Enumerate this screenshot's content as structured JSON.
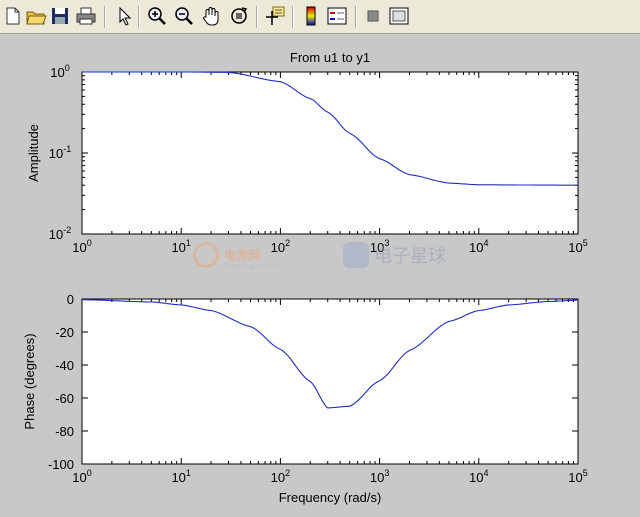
{
  "toolbar": {
    "buttons": [
      {
        "name": "new-figure-icon",
        "label": "New Figure"
      },
      {
        "name": "open-file-icon",
        "label": "Open File"
      },
      {
        "name": "save-figure-icon",
        "label": "Save Figure"
      },
      {
        "name": "print-figure-icon",
        "label": "Print Figure"
      },
      {
        "name": "edit-plot-icon",
        "label": "Edit Plot"
      },
      {
        "name": "zoom-in-icon",
        "label": "Zoom In"
      },
      {
        "name": "zoom-out-icon",
        "label": "Zoom Out"
      },
      {
        "name": "pan-icon",
        "label": "Pan"
      },
      {
        "name": "rotate-3d-icon",
        "label": "Rotate 3D"
      },
      {
        "name": "data-cursor-icon",
        "label": "Data Cursor"
      },
      {
        "name": "insert-colorbar-icon",
        "label": "Insert Colorbar"
      },
      {
        "name": "insert-legend-icon",
        "label": "Insert Legend"
      },
      {
        "name": "hide-plot-tools-icon",
        "label": "Hide Plot Tools"
      },
      {
        "name": "show-plot-tools-icon",
        "label": "Show Plot Tools"
      }
    ]
  },
  "watermark": {
    "left_brand": "电源网",
    "left_site": "DianYuan.com",
    "right_brand": "电子星球"
  },
  "chart_data": [
    {
      "type": "line",
      "title": "From u1 to y1",
      "xlabel": "",
      "ylabel": "Amplitude",
      "xscale": "log",
      "yscale": "log",
      "xlim": [
        1,
        100000
      ],
      "ylim": [
        0.01,
        1
      ],
      "x_ticks": [
        {
          "value": 1,
          "base": "10",
          "exp": "0"
        },
        {
          "value": 10,
          "base": "10",
          "exp": "1"
        },
        {
          "value": 100,
          "base": "10",
          "exp": "2"
        },
        {
          "value": 1000,
          "base": "10",
          "exp": "3"
        },
        {
          "value": 10000,
          "base": "10",
          "exp": "4"
        },
        {
          "value": 100000,
          "base": "10",
          "exp": "5"
        }
      ],
      "y_ticks": [
        {
          "value": 0.01,
          "base": "10",
          "exp": "-2"
        },
        {
          "value": 0.1,
          "base": "10",
          "exp": "-1"
        },
        {
          "value": 1,
          "base": "10",
          "exp": "0"
        }
      ],
      "grid": false,
      "series": [
        {
          "color": "#1f2fbf",
          "x": [
            1,
            10,
            30,
            100,
            200,
            300,
            500,
            1000,
            2000,
            5000,
            10000,
            100000
          ],
          "y": [
            1,
            1,
            0.99,
            0.76,
            0.47,
            0.32,
            0.175,
            0.085,
            0.054,
            0.0425,
            0.0405,
            0.04
          ]
        }
      ]
    },
    {
      "type": "line",
      "title": "",
      "xlabel": "Frequency (rad/s)",
      "ylabel": "Phase (degrees)",
      "xscale": "log",
      "yscale": "linear",
      "xlim": [
        1,
        100000
      ],
      "ylim": [
        -100,
        0
      ],
      "x_ticks": [
        {
          "value": 1,
          "base": "10",
          "exp": "0"
        },
        {
          "value": 10,
          "base": "10",
          "exp": "1"
        },
        {
          "value": 100,
          "base": "10",
          "exp": "2"
        },
        {
          "value": 1000,
          "base": "10",
          "exp": "3"
        },
        {
          "value": 10000,
          "base": "10",
          "exp": "4"
        },
        {
          "value": 100000,
          "base": "10",
          "exp": "5"
        }
      ],
      "y_ticks": [
        {
          "value": 0,
          "label": "0"
        },
        {
          "value": -20,
          "label": "-20"
        },
        {
          "value": -40,
          "label": "-40"
        },
        {
          "value": -60,
          "label": "-60"
        },
        {
          "value": -80,
          "label": "-80"
        },
        {
          "value": -100,
          "label": "-100"
        }
      ],
      "grid": false,
      "series": [
        {
          "color": "#1f2fbf",
          "x": [
            1,
            5,
            10,
            20,
            50,
            100,
            200,
            300,
            500,
            1000,
            2000,
            5000,
            10000,
            20000,
            50000,
            100000
          ],
          "y": [
            -0.4,
            -1.8,
            -3.6,
            -7,
            -16.7,
            -30.5,
            -50,
            -66,
            -65,
            -49.5,
            -31.2,
            -13.6,
            -7,
            -3.6,
            -1.5,
            -0.7
          ]
        }
      ]
    }
  ]
}
